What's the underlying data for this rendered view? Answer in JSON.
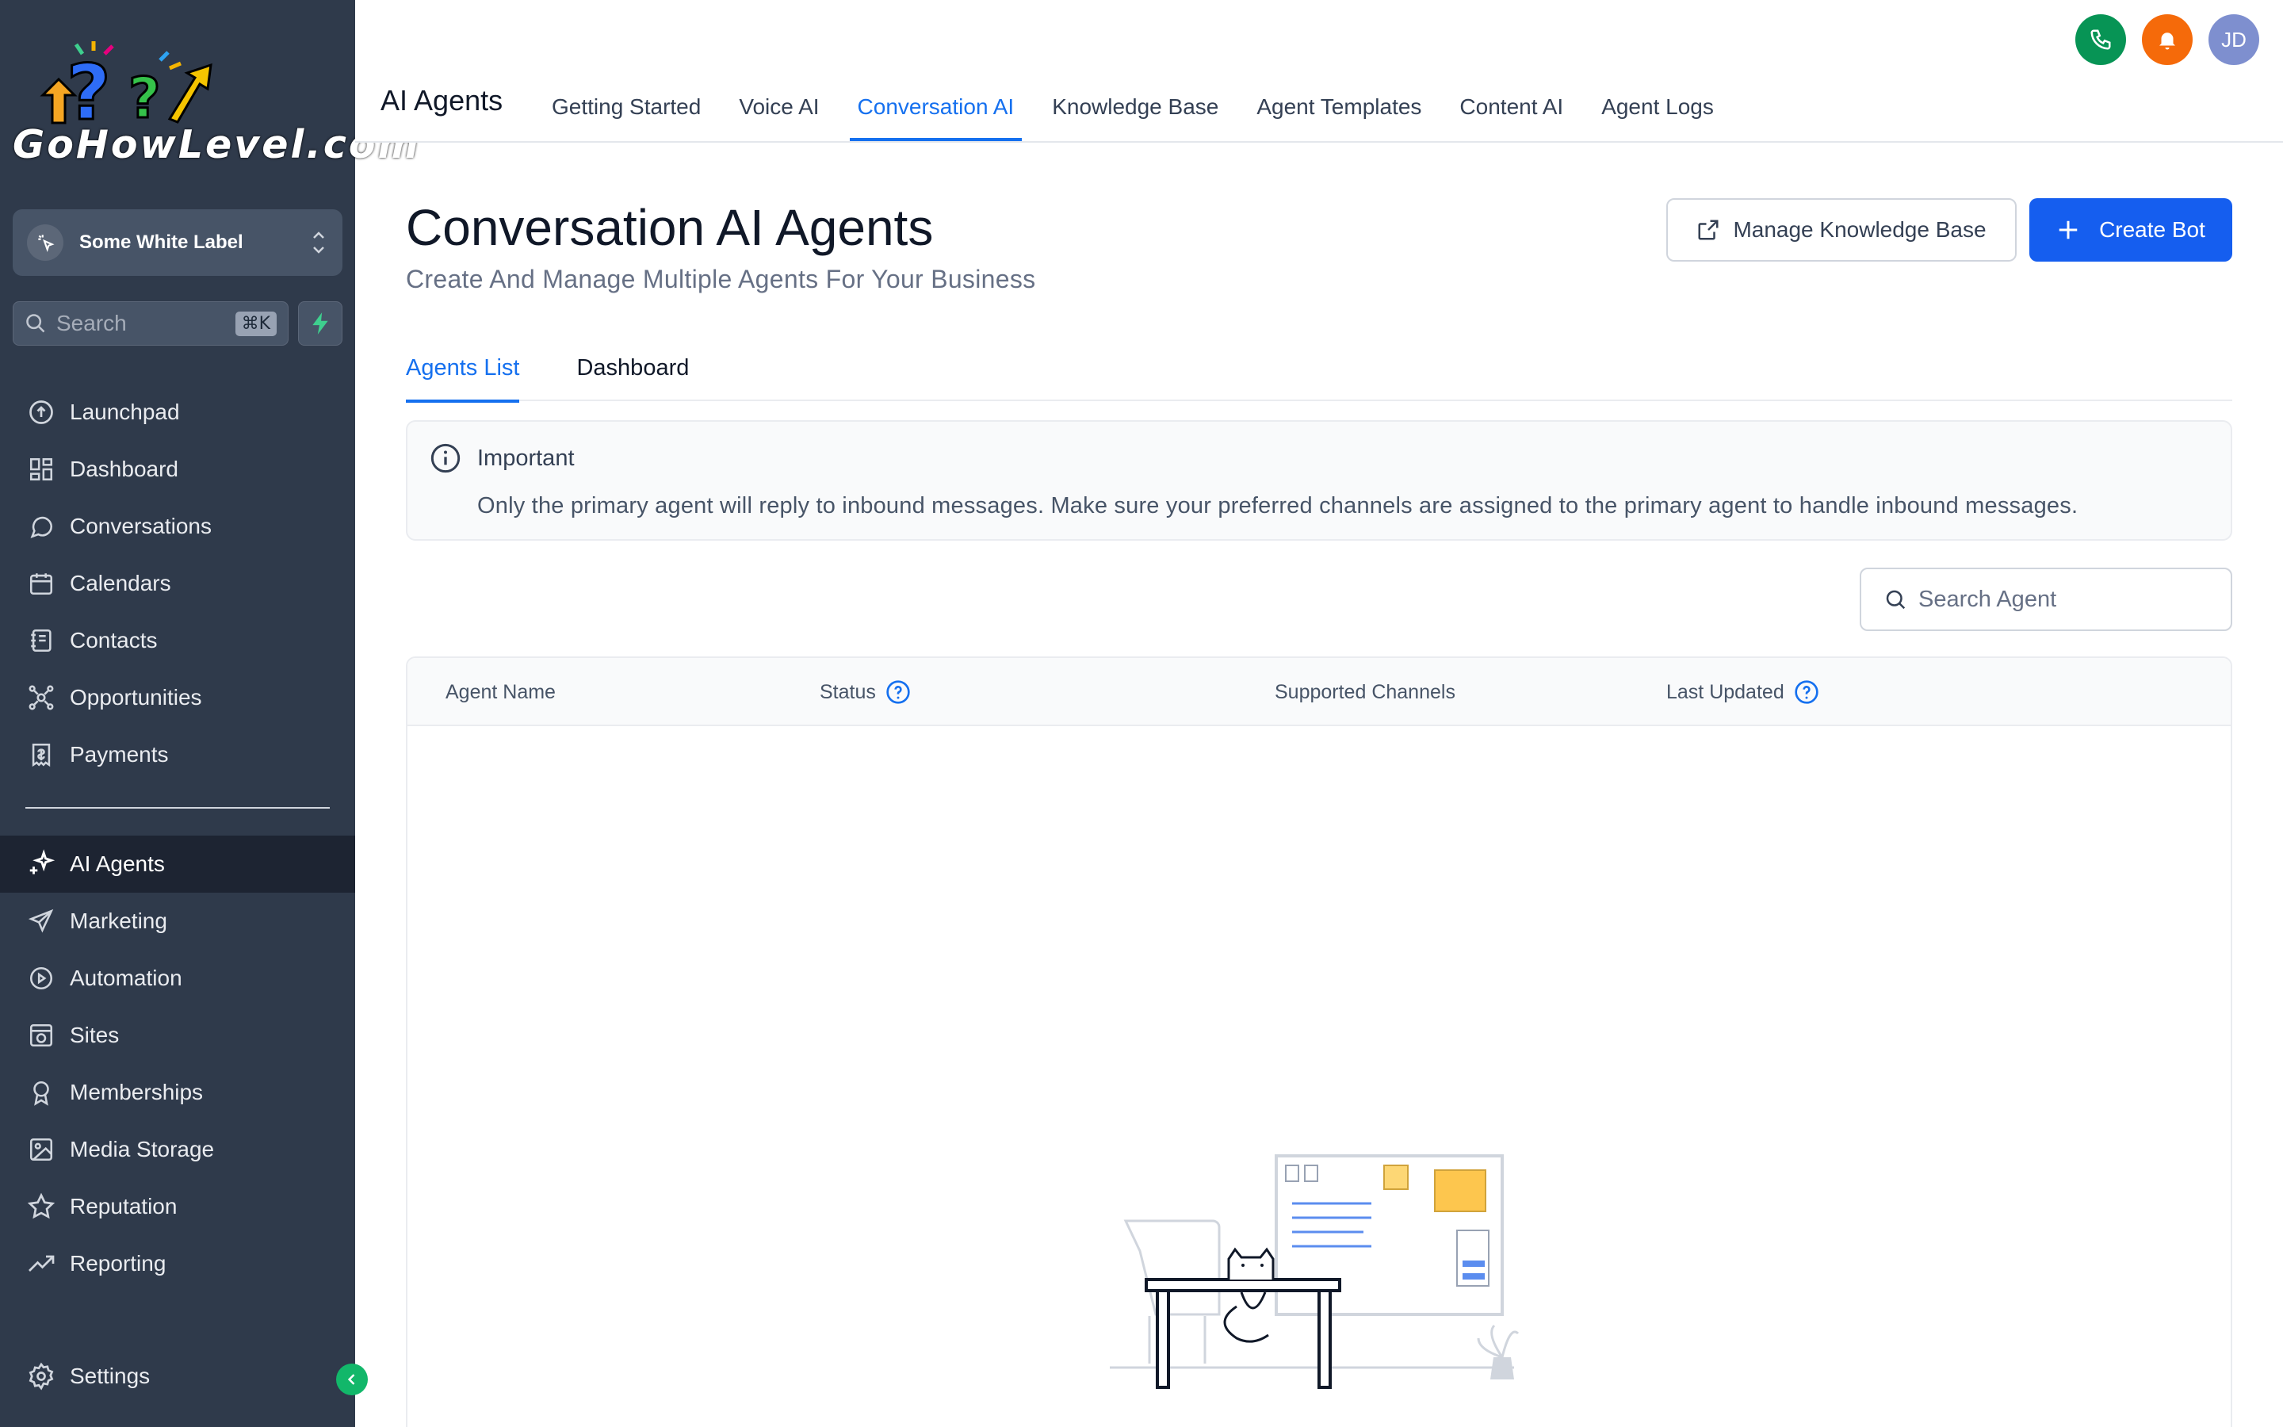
{
  "brand": {
    "logo_text": "GoHowLevel.com"
  },
  "sidebar": {
    "account_switcher": {
      "label": "Some White Label"
    },
    "search": {
      "placeholder": "Search",
      "shortcut": "⌘K"
    },
    "items": [
      {
        "label": "Launchpad",
        "icon": "launchpad-icon"
      },
      {
        "label": "Dashboard",
        "icon": "dashboard-icon"
      },
      {
        "label": "Conversations",
        "icon": "chat-bubble-icon"
      },
      {
        "label": "Calendars",
        "icon": "calendar-icon"
      },
      {
        "label": "Contacts",
        "icon": "contacts-icon"
      },
      {
        "label": "Opportunities",
        "icon": "opportunities-icon"
      },
      {
        "label": "Payments",
        "icon": "payments-icon"
      }
    ],
    "items2": [
      {
        "label": "AI Agents",
        "icon": "sparkle-icon",
        "active": true
      },
      {
        "label": "Marketing",
        "icon": "send-icon"
      },
      {
        "label": "Automation",
        "icon": "automation-icon"
      },
      {
        "label": "Sites",
        "icon": "sites-icon"
      },
      {
        "label": "Memberships",
        "icon": "award-icon"
      },
      {
        "label": "Media Storage",
        "icon": "image-icon"
      },
      {
        "label": "Reputation",
        "icon": "star-icon"
      },
      {
        "label": "Reporting",
        "icon": "trend-icon"
      }
    ],
    "settings_label": "Settings"
  },
  "header": {
    "title": "AI Agents",
    "tabs": [
      {
        "label": "Getting Started"
      },
      {
        "label": "Voice AI"
      },
      {
        "label": "Conversation AI",
        "active": true
      },
      {
        "label": "Knowledge Base"
      },
      {
        "label": "Agent Templates"
      },
      {
        "label": "Content AI"
      },
      {
        "label": "Agent Logs"
      }
    ],
    "avatar_initials": "JD"
  },
  "main": {
    "title": "Conversation AI Agents",
    "subtitle": "Create And Manage Multiple Agents For Your Business",
    "manage_kb_label": "Manage Knowledge Base",
    "create_bot_label": "Create Bot",
    "tabs": [
      {
        "label": "Agents List",
        "active": true
      },
      {
        "label": "Dashboard"
      }
    ],
    "notice": {
      "title": "Important",
      "text": "Only the primary agent will reply to inbound messages. Make sure your preferred channels are assigned to the primary agent to handle inbound messages."
    },
    "search_placeholder": "Search Agent",
    "table": {
      "columns": [
        {
          "label": "Agent Name",
          "help": false
        },
        {
          "label": "Status",
          "help": true
        },
        {
          "label": "Supported Channels",
          "help": false
        },
        {
          "label": "Last Updated",
          "help": true
        }
      ]
    }
  },
  "colors": {
    "sidebar_bg": "#2f3a4b",
    "accent": "#155eef",
    "phone_green": "#079455",
    "bell_orange": "#f56a0a",
    "avatar_blue": "#7e8fcf"
  }
}
